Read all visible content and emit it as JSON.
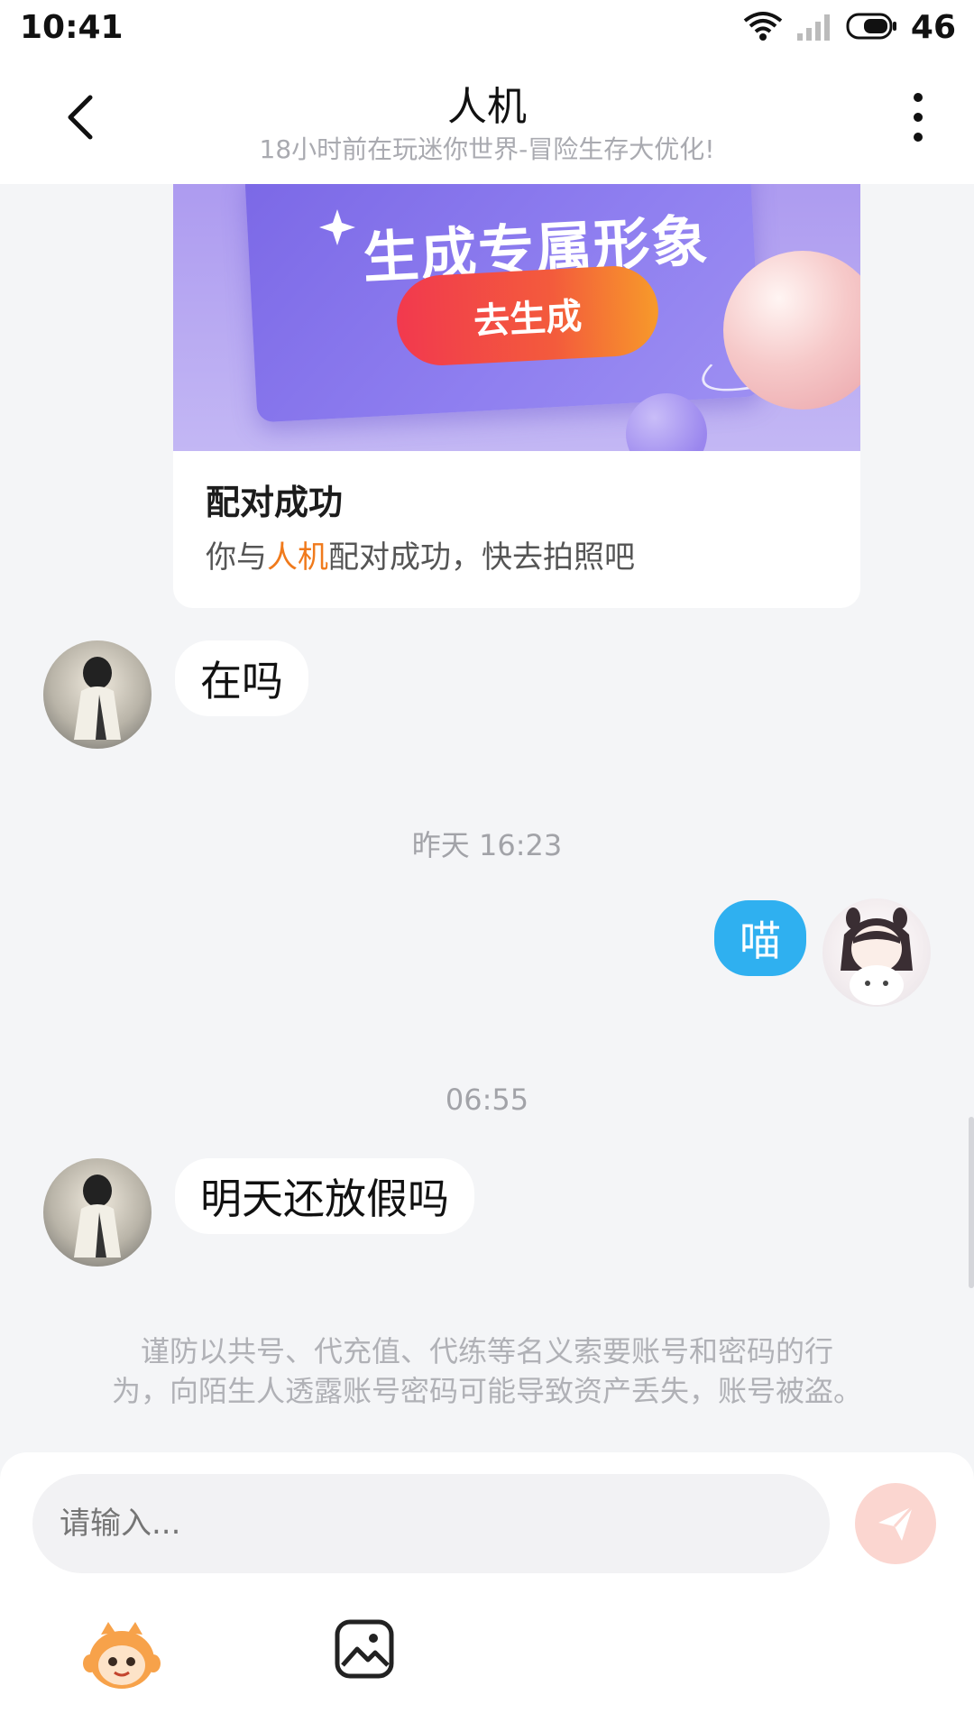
{
  "status_bar": {
    "time": "10:41",
    "battery": "46"
  },
  "header": {
    "title": "人机",
    "subtitle": "18小时前在玩迷你世界-冒险生存大优化!"
  },
  "card": {
    "banner_heading": "生成专属形象",
    "banner_button": "去生成",
    "title": "配对成功",
    "desc_prefix": "你与",
    "desc_highlight": "人机",
    "desc_suffix": "配对成功，快去拍照吧",
    "highlight_color": "#f07a1c"
  },
  "messages": [
    {
      "side": "left",
      "text": "在吗"
    },
    {
      "side": "right",
      "text": "喵"
    },
    {
      "side": "left",
      "text": "明天还放假吗"
    }
  ],
  "timestamps": [
    "昨天 16:23",
    "06:55"
  ],
  "notice": {
    "line1": "谨防以共号、代充值、代练等名义索要账号和密码的行",
    "line2": "为，向陌生人透露账号密码可能导致资产丢失，账号被盗。"
  },
  "input": {
    "placeholder": "请输入..."
  },
  "colors": {
    "sent_bubble": "#2fb0f0",
    "accent": "#f07a1c"
  },
  "icons": [
    "back-icon",
    "more-icon",
    "wifi-icon",
    "signal-icon",
    "battery-icon",
    "send-icon",
    "mascot-icon",
    "image-icon"
  ]
}
